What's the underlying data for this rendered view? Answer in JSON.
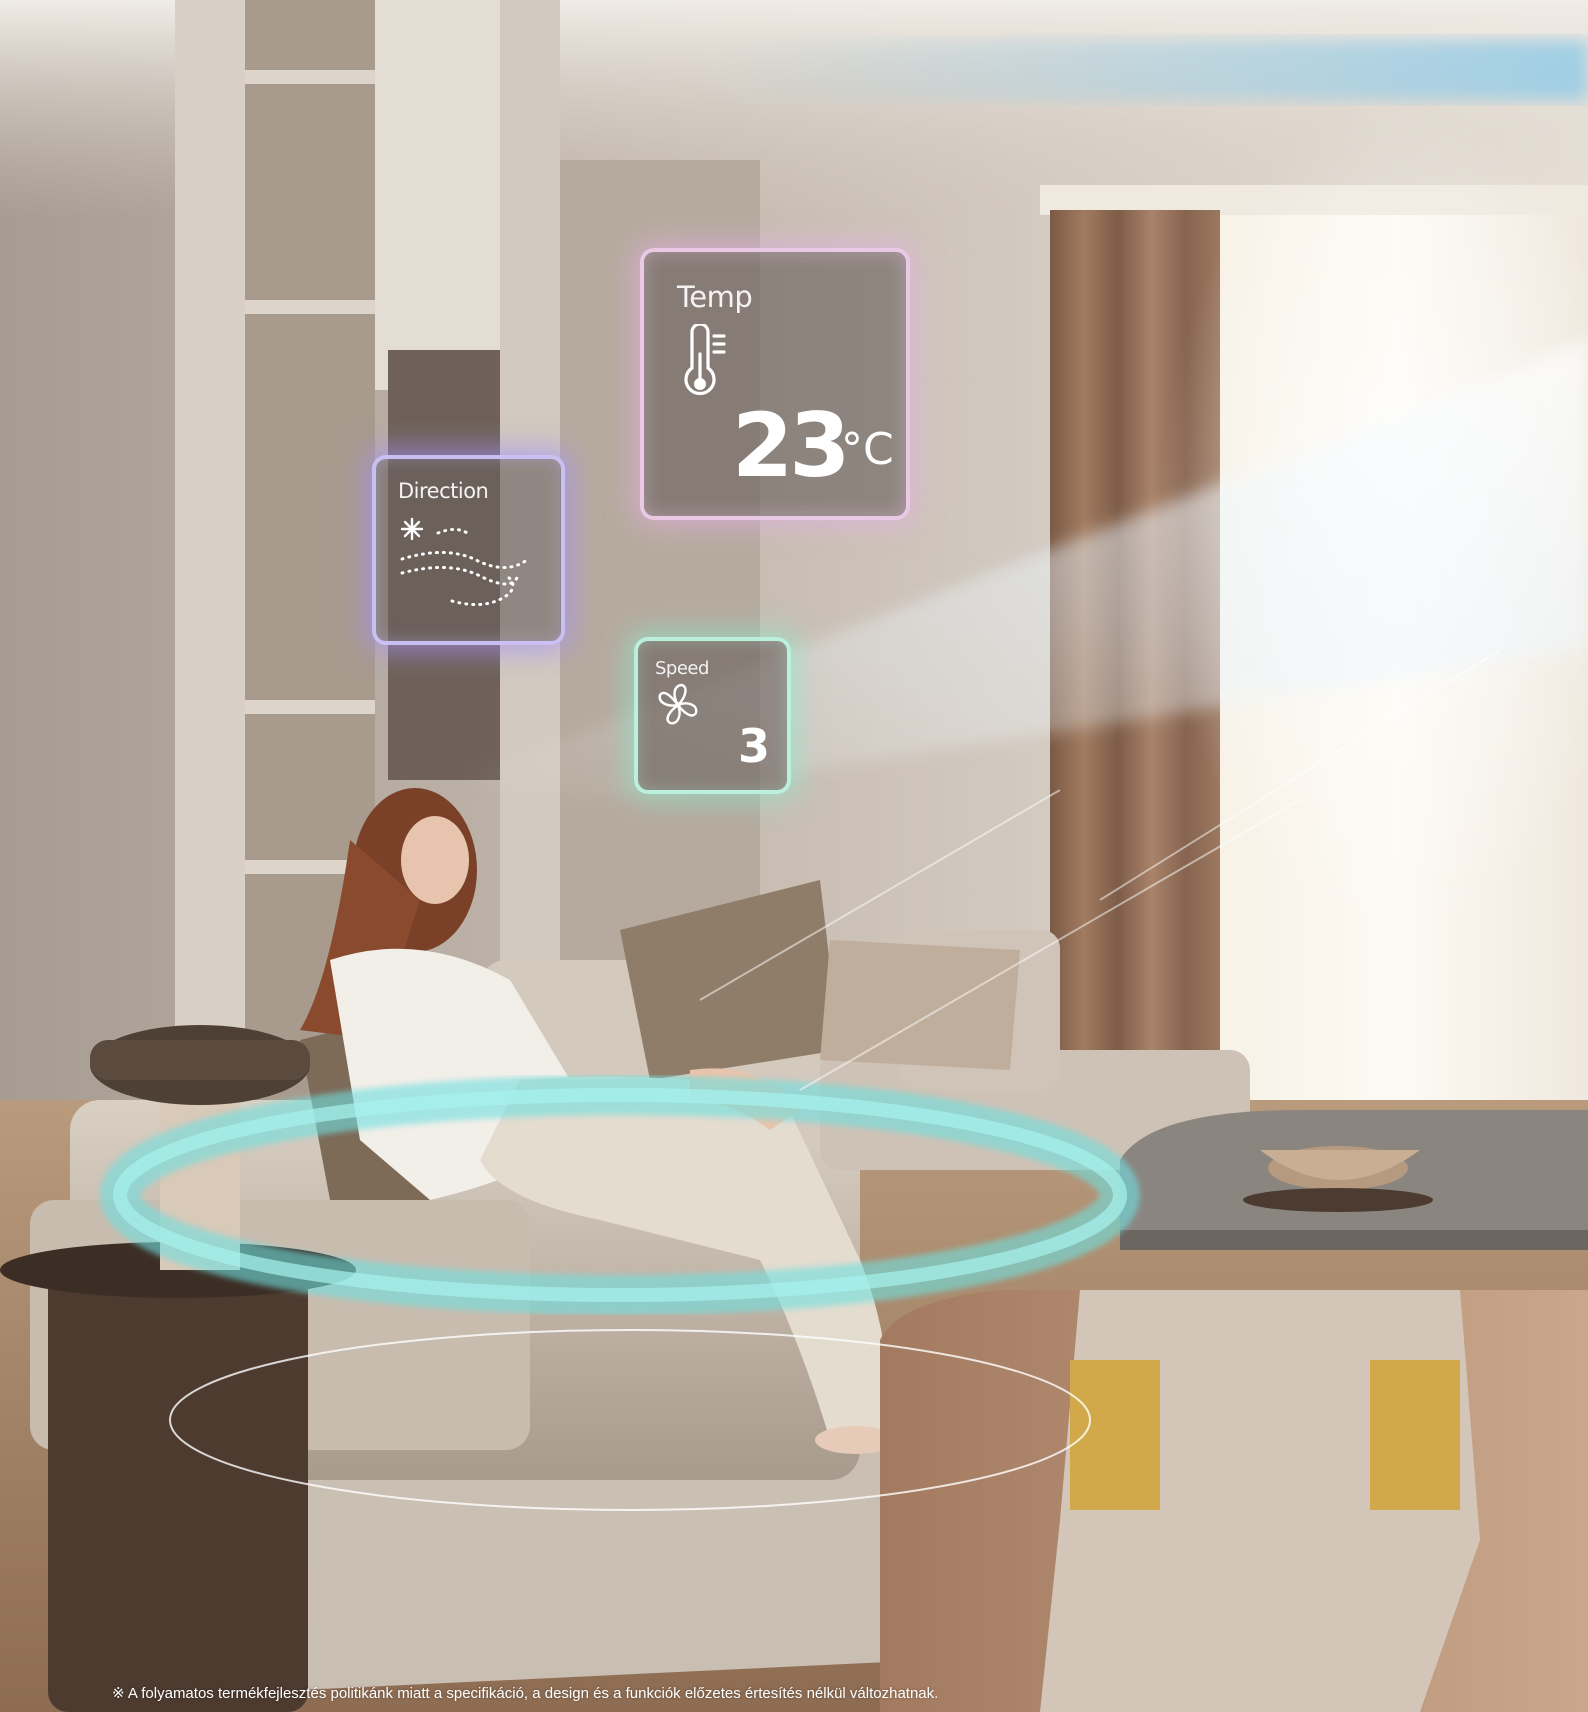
{
  "panels": {
    "temp": {
      "label": "Temp",
      "value": "23",
      "unit": "°C",
      "icon": "thermometer-icon"
    },
    "direction": {
      "label": "Direction",
      "icon": "airflow-direction-icon"
    },
    "speed": {
      "label": "Speed",
      "value": "3",
      "icon": "fan-icon"
    }
  },
  "disclaimer": "※ A folyamatos termékfejlesztés politikánk miatt a specifikáció, a design és a funkciók előzetes értesítés nélkül változhatnak.",
  "colors": {
    "temp_glow": "#e6afe6",
    "direction_glow": "#a591fa",
    "speed_glow": "#8cebcd",
    "airflow_ring": "#6fe0e0"
  }
}
